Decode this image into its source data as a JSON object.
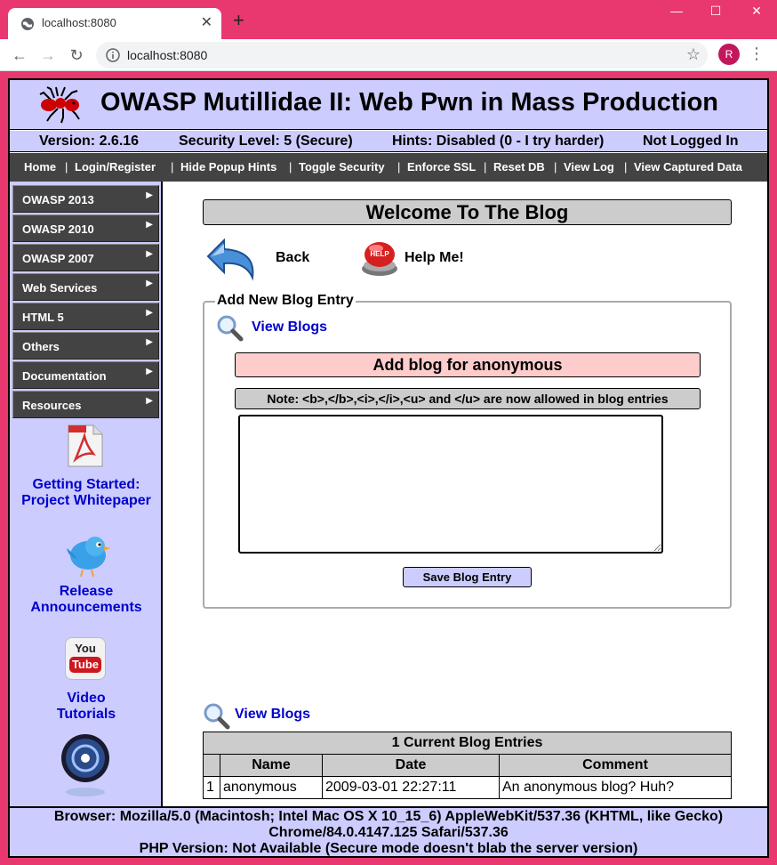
{
  "browser": {
    "tab_title": "localhost:8080",
    "url": "localhost:8080",
    "profile_initial": "R",
    "accent_color": "#e8386f"
  },
  "site": {
    "title": "OWASP Mutillidae II: Web Pwn in Mass Production",
    "version": "Version: 2.6.16",
    "security_level": "Security Level: 5 (Secure)",
    "hints": "Hints: Disabled (0 - I try harder)",
    "login_status": "Not Logged In"
  },
  "menu": {
    "items": [
      "Home",
      "Login/Register",
      "Hide Popup Hints",
      "Toggle Security",
      "Enforce SSL",
      "Reset DB",
      "View Log",
      "View Captured Data"
    ]
  },
  "sidebar": {
    "items": [
      "OWASP 2013",
      "OWASP 2010",
      "OWASP 2007",
      "Web Services",
      "HTML 5",
      "Others",
      "Documentation",
      "Resources"
    ],
    "links": {
      "getting_started_line1": "Getting Started:",
      "getting_started_line2": "Project Whitepaper",
      "release_line1": "Release",
      "release_line2": "Announcements",
      "video_line1": "Video",
      "video_line2": "Tutorials",
      "youtube_top": "You",
      "youtube_bottom": "Tube"
    }
  },
  "content": {
    "page_title": "Welcome To The Blog",
    "back_label": "Back",
    "help_label": "Help Me!",
    "help_badge": "HELP",
    "form": {
      "legend": "Add New Blog Entry",
      "view_blogs": "View Blogs",
      "add_header": "Add blog for anonymous",
      "note": "Note: <b>,</b>,<i>,</i>,<u> and </u> are now allowed in blog entries",
      "textarea_value": "",
      "save_label": "Save Blog Entry"
    },
    "view_blogs_link": "View Blogs",
    "table": {
      "caption": "1 Current Blog Entries",
      "headers": [
        "",
        "Name",
        "Date",
        "Comment"
      ],
      "rows": [
        [
          "1",
          "anonymous",
          "2009-03-01 22:27:11",
          "An anonymous blog? Huh?"
        ]
      ]
    }
  },
  "footer": {
    "browser_line1": "Browser: Mozilla/5.0 (Macintosh; Intel Mac OS X 10_15_6) AppleWebKit/537.36 (KHTML, like Gecko)",
    "browser_line2": "Chrome/84.0.4147.125 Safari/537.36",
    "php_line": "PHP Version: Not Available (Secure mode doesn't blab the server version)"
  }
}
